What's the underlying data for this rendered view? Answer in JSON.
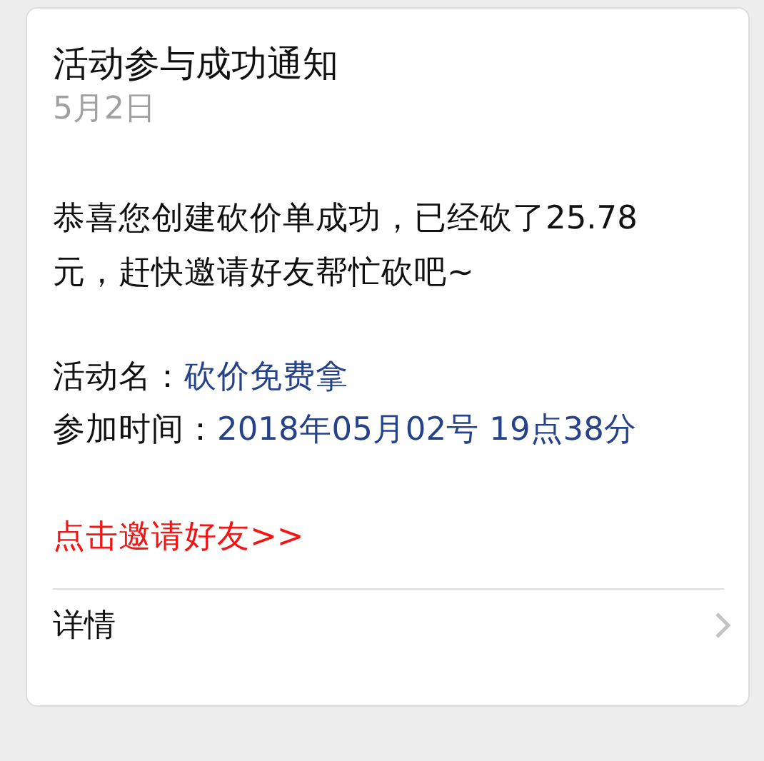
{
  "card": {
    "title": "活动参与成功通知",
    "date": "5月2日",
    "message": "恭喜您创建砍价单成功，已经砍了25.78元，赶快邀请好友帮忙砍吧~",
    "fields": [
      {
        "label": "活动名：",
        "value": "砍价免费拿"
      },
      {
        "label": "参加时间：",
        "value": "2018年05月02号 19点38分"
      }
    ],
    "link": "点击邀请好友>>",
    "footer": {
      "label": "详情"
    }
  }
}
